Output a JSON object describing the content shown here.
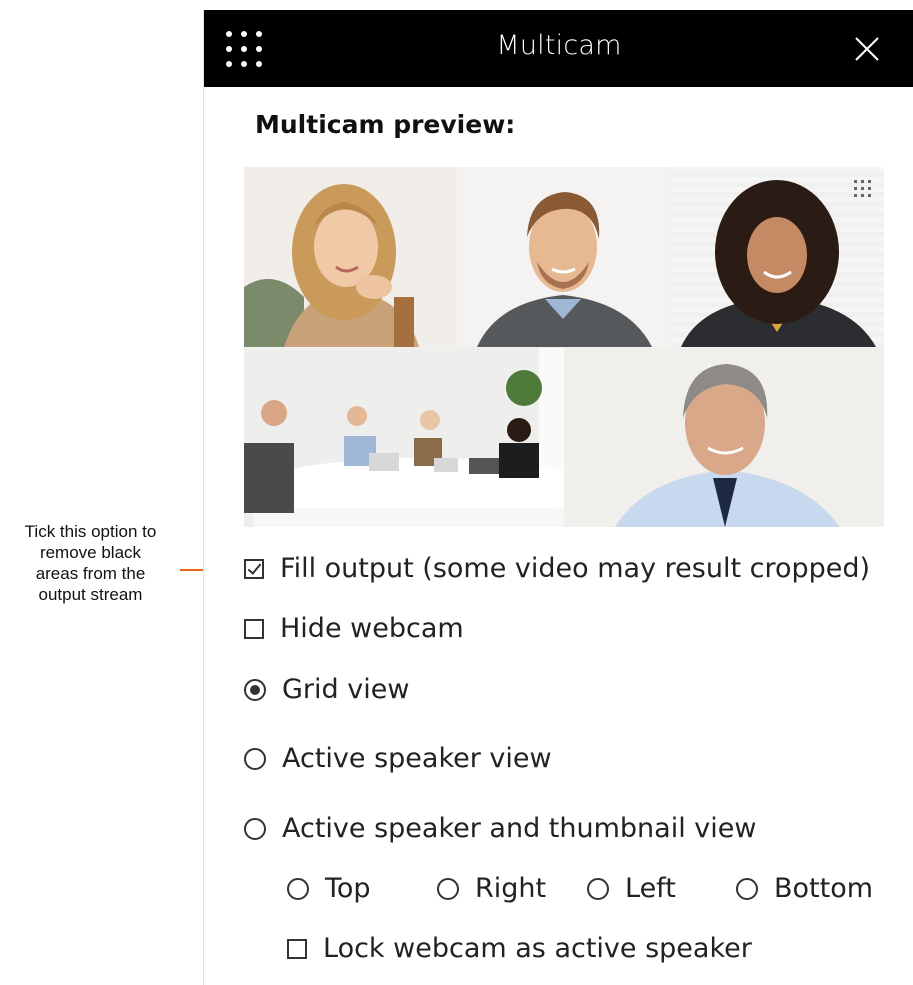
{
  "annotation": {
    "lines": [
      "Tick this option to",
      "remove black",
      "areas from the",
      "output stream"
    ],
    "arrow_color": "#e8661a"
  },
  "header": {
    "title": "Multicam",
    "menu_icon": "grid-dots-icon",
    "close_icon": "close-icon",
    "background": "#000000"
  },
  "preview": {
    "heading": "Multicam preview:"
  },
  "options": {
    "fill_output": {
      "label": "Fill output (some video may result cropped)",
      "checked": true
    },
    "hide_webcam": {
      "label": "Hide webcam",
      "checked": false
    },
    "grid_view": {
      "label": "Grid view",
      "selected": true
    },
    "active_speaker_view": {
      "label": "Active speaker view",
      "selected": false
    },
    "active_speaker_thumbnail_view": {
      "label": "Active speaker and thumbnail view",
      "selected": false
    },
    "thumbnail_position": {
      "top": "Top",
      "right": "Right",
      "left": "Left",
      "bottom": "Bottom"
    },
    "lock_webcam": {
      "label": "Lock webcam as active speaker",
      "checked": false
    }
  }
}
